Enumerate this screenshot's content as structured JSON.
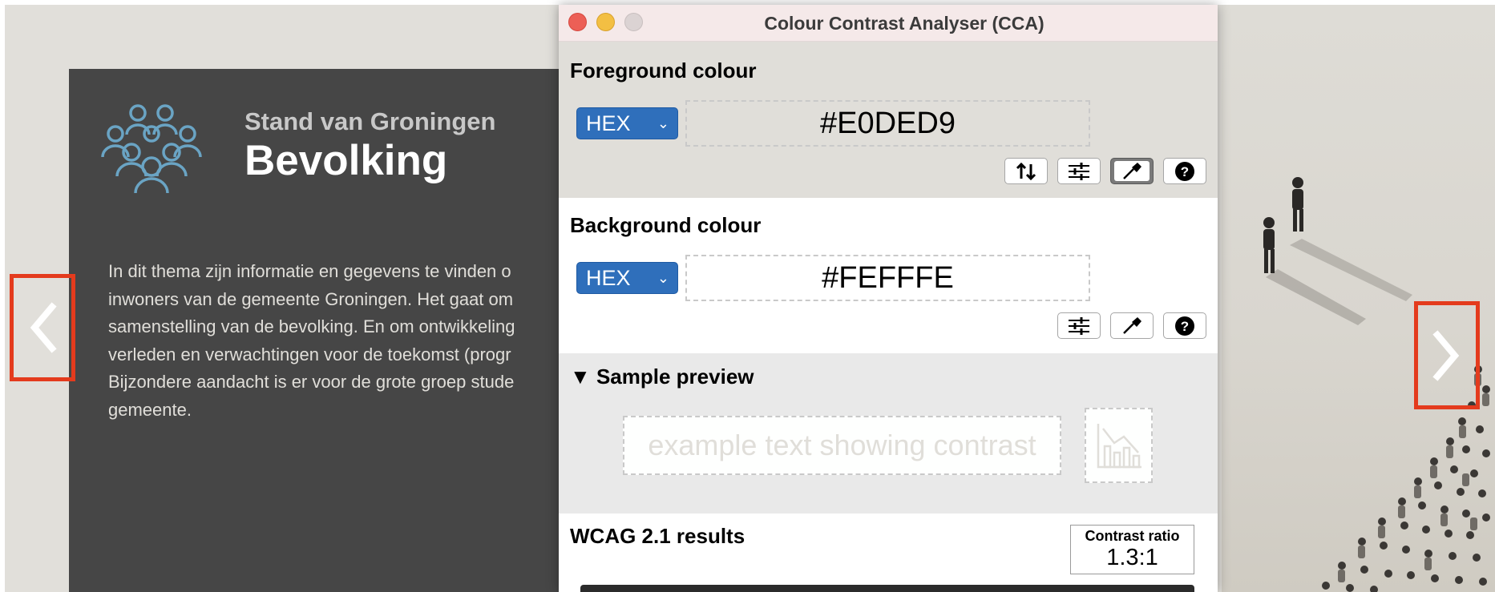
{
  "background_page": {
    "kicker": "Stand van Groningen",
    "headline": "Bevolking",
    "intro_lines": [
      "In dit thema zijn informatie en gegevens te vinden o",
      "inwoners van de gemeente Groningen. Het gaat om",
      "samenstelling van de bevolking. En om ontwikkeling",
      "verleden en verwachtingen voor de toekomst (progr",
      "Bijzondere aandacht is er voor de grote groep stude",
      "gemeente."
    ],
    "prev_icon": "chevron-left-icon",
    "next_icon": "chevron-right-icon",
    "logo_icon": "people-group-icon",
    "panel_color": "#464646",
    "highlight_color": "#e43b1d"
  },
  "cca": {
    "window_title": "Colour Contrast Analyser (CCA)",
    "foreground": {
      "title": "Foreground colour",
      "format": "HEX",
      "value": "#E0DED9",
      "tools": [
        "swap-icon",
        "sliders-icon",
        "eyedropper-icon",
        "help-icon"
      ]
    },
    "background": {
      "title": "Background colour",
      "format": "HEX",
      "value": "#FEFFFE",
      "tools": [
        "sliders-icon",
        "eyedropper-icon",
        "help-icon"
      ]
    },
    "sample_preview": {
      "title": "Sample preview",
      "text": "example text showing contrast",
      "icon": "bar-chart-icon"
    },
    "results": {
      "title": "WCAG 2.1 results",
      "ratio_label": "Contrast ratio",
      "ratio_value": "1.3:1"
    }
  }
}
